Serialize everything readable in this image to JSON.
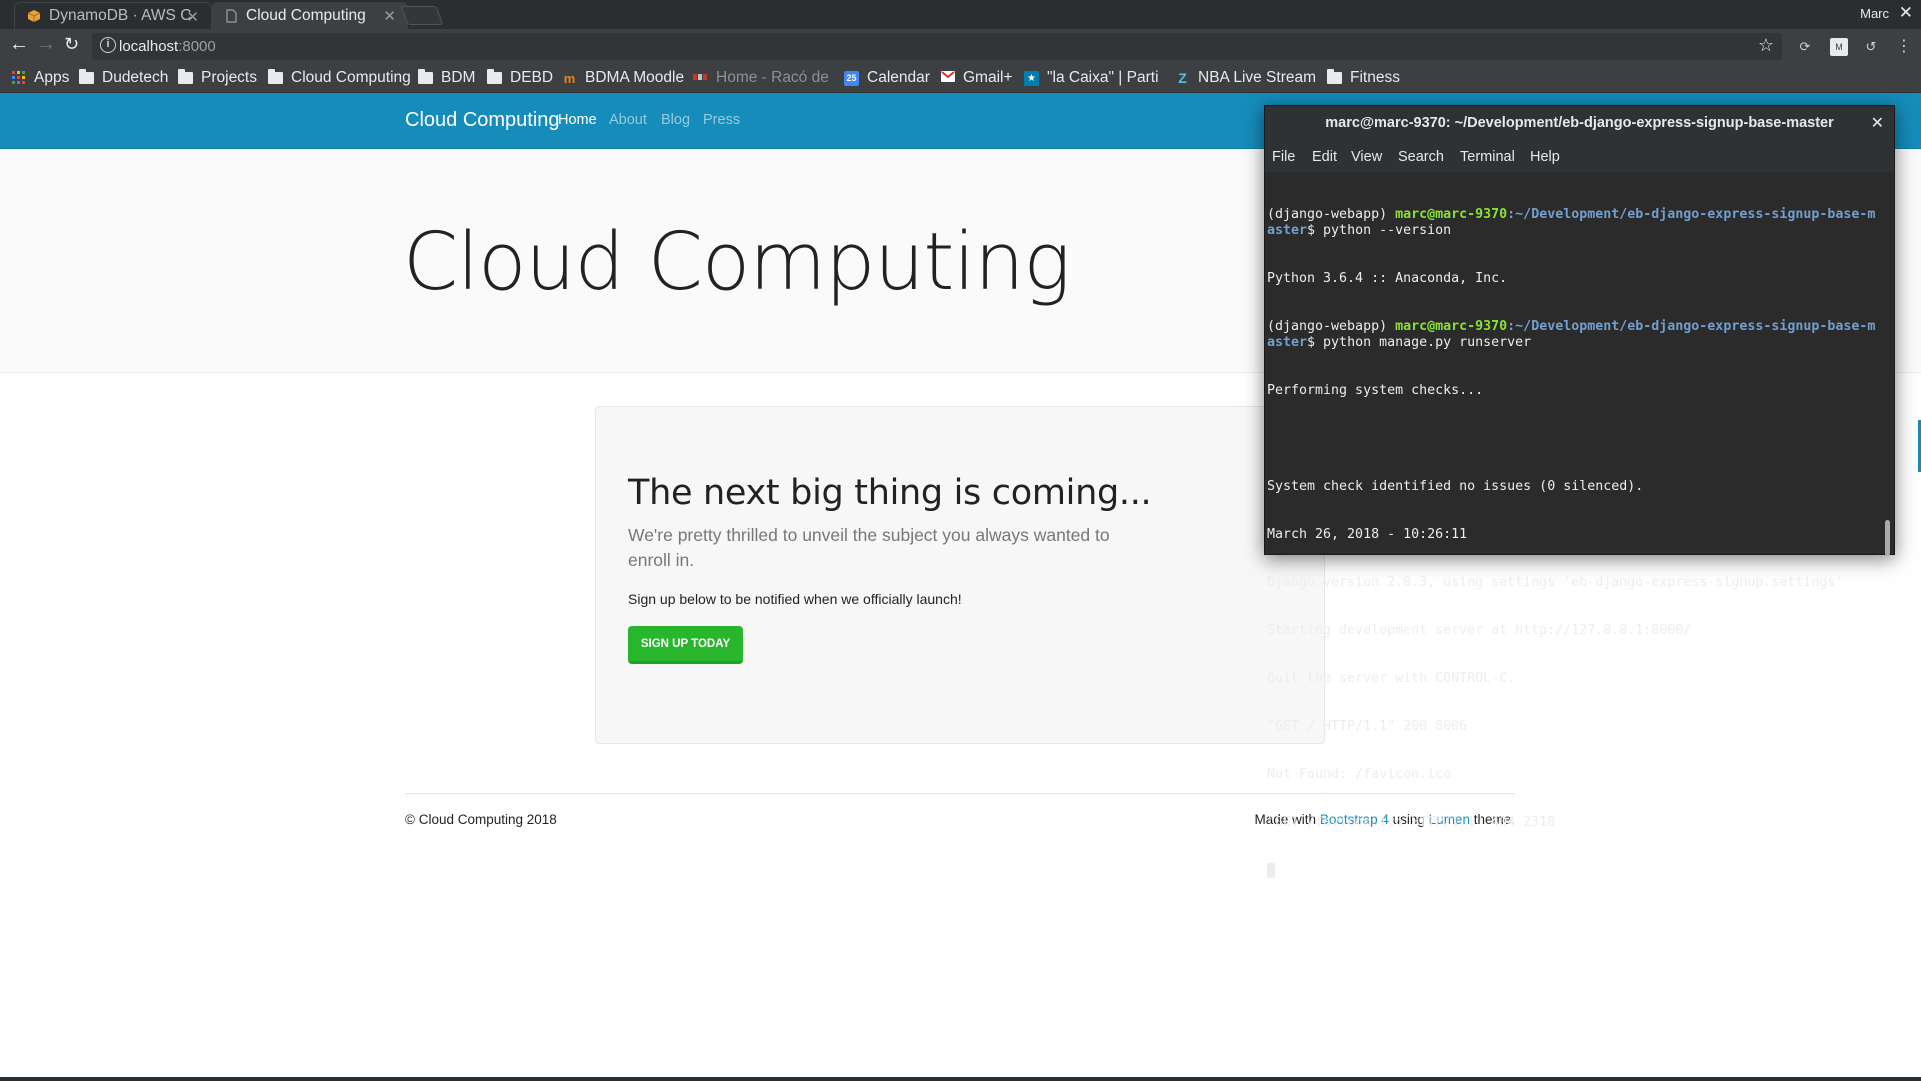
{
  "browser": {
    "tabs": [
      {
        "label": "DynamoDB · AWS C",
        "active": false,
        "icon": "aws-box-icon"
      },
      {
        "label": "Cloud Computing",
        "active": true,
        "icon": "page-icon"
      }
    ],
    "user_name": "Marc",
    "url_host": "localhost",
    "url_port": ":8000",
    "bookmarks": [
      {
        "label": "Apps",
        "icon": "apps-grid-icon"
      },
      {
        "label": "Dudetech",
        "icon": "folder-icon"
      },
      {
        "label": "Projects",
        "icon": "folder-icon"
      },
      {
        "label": "Cloud Computing",
        "icon": "folder-icon"
      },
      {
        "label": "BDM",
        "icon": "folder-icon"
      },
      {
        "label": "DEBD",
        "icon": "folder-icon"
      },
      {
        "label": "BDMA Moodle",
        "icon": "moodle-icon"
      },
      {
        "label": "Home - Racó de",
        "icon": "raco-icon"
      },
      {
        "label": "Calendar",
        "icon": "calendar-icon",
        "badge": "25"
      },
      {
        "label": "Gmail+",
        "icon": "gmail-icon"
      },
      {
        "label": "\"la Caixa\" | Parti",
        "icon": "caixa-icon"
      },
      {
        "label": "NBA Live Stream",
        "icon": "z-icon"
      },
      {
        "label": "Fitness",
        "icon": "folder-icon"
      }
    ]
  },
  "site": {
    "brand": "Cloud Computing",
    "nav": [
      "Home",
      "About",
      "Blog",
      "Press"
    ],
    "hero_title": "Cloud Computing",
    "card": {
      "title": "The next big thing is coming...",
      "lead": "We're pretty thrilled to unveil the subject you always wanted to enroll in.",
      "text": "Sign up below to be notified when we officially launch!",
      "button": "Sign Up Today"
    },
    "footer": {
      "copyright": "© Cloud Computing 2018",
      "made_with": "Made with",
      "bootstrap": "Bootstrap 4",
      "using": "using",
      "lumen": "Lumen",
      "theme": "theme."
    },
    "colors": {
      "navbar": "#158cba",
      "button": "#28b62c"
    }
  },
  "terminal": {
    "title": "marc@marc-9370: ~/Development/eb-django-express-signup-base-master",
    "menu": [
      "File",
      "Edit",
      "View",
      "Search",
      "Terminal",
      "Help"
    ],
    "prompt_env": "(django-webapp) ",
    "prompt_user": "marc@marc-9370",
    "prompt_path": ":~/Development/eb-django-express-signup-base-master",
    "prompt_symbol": "$ ",
    "cmd1": "python --version",
    "cmd2": "python manage.py runserver",
    "output_1": [
      "Python 3.6.4 :: Anaconda, Inc."
    ],
    "output_2": [
      "Performing system checks...",
      "",
      "System check identified no issues (0 silenced).",
      "March 26, 2018 - 10:26:11",
      "Django version 2.0.3, using settings 'eb-django-express-signup.settings'",
      "Starting development server at http://127.0.0.1:8000/",
      "Quit the server with CONTROL-C.",
      "\"GET / HTTP/1.1\" 200 8006",
      "Not Found: /favicon.ico",
      "\"GET /favicon.ico HTTP/1.1\" 404 2318"
    ]
  }
}
